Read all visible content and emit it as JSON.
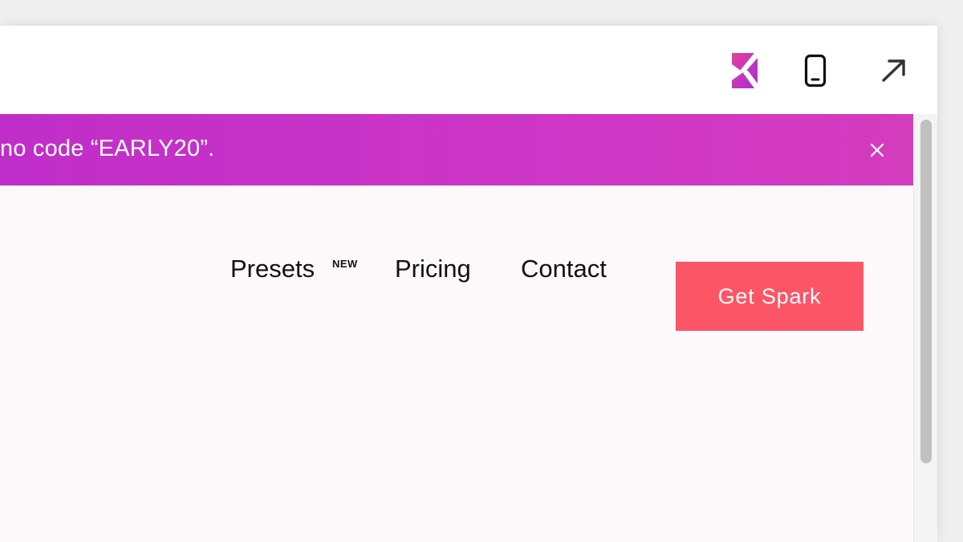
{
  "toolbar": {
    "logo_icon": "kickoff-k-logo-icon",
    "phone_icon": "mobile-device-icon",
    "external_icon": "open-external-arrow-icon"
  },
  "promo": {
    "text": "no code “EARLY20”.",
    "close_icon": "close-icon",
    "color_start": "#c02ec9",
    "color_end": "#d43cbe"
  },
  "nav": {
    "presets": "Presets",
    "presets_badge": "NEW",
    "pricing": "Pricing",
    "contact": "Contact",
    "cta": "Get Spark",
    "cta_color": "#fb5566"
  },
  "scrollbar": {
    "icon": "vertical-scrollbar"
  }
}
